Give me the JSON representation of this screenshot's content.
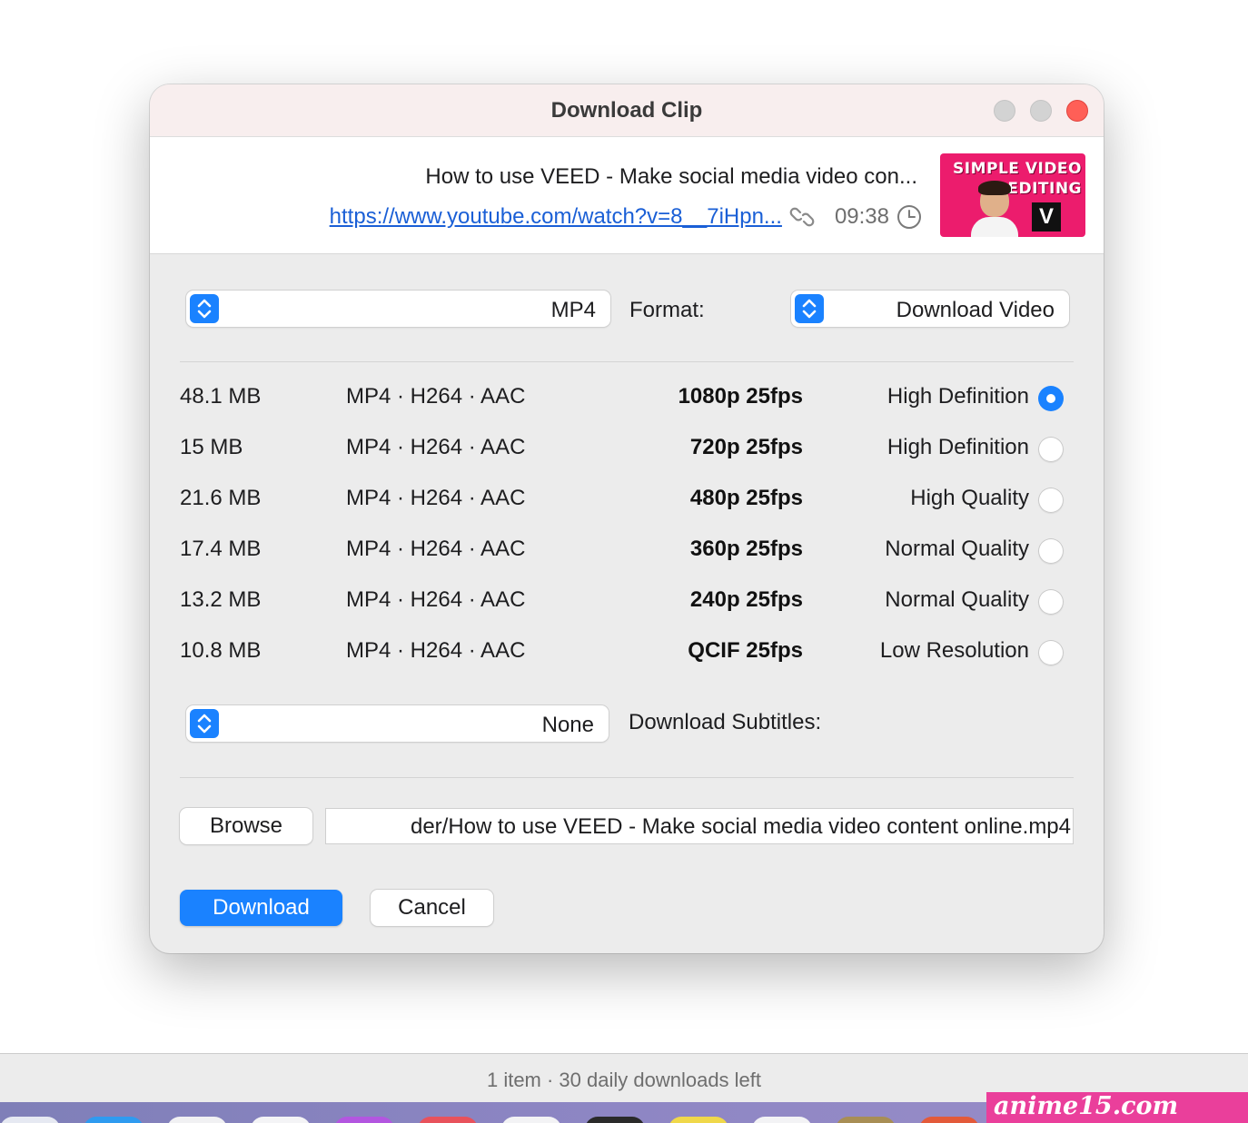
{
  "dialog": {
    "title": "Download Clip"
  },
  "video": {
    "title": "How to use VEED - Make social media video con...",
    "url": "https://www.youtube.com/watch?v=8__7iHpn...",
    "duration": "09:38",
    "thumbnail": {
      "line1": "SIMPLE VIDEO",
      "line2": "EDITING",
      "badge": "V"
    }
  },
  "download_type": {
    "value": "Download Video"
  },
  "format": {
    "label": "Format:",
    "value": "MP4"
  },
  "qualities": [
    {
      "label": "High Definition",
      "resolution": "1080p 25fps",
      "codec": "MP4 · H264 · AAC",
      "size": "48.1 MB",
      "selected": true
    },
    {
      "label": "High Definition",
      "resolution": "720p 25fps",
      "codec": "MP4 · H264 · AAC",
      "size": "15 MB",
      "selected": false
    },
    {
      "label": "High Quality",
      "resolution": "480p 25fps",
      "codec": "MP4 · H264 · AAC",
      "size": "21.6 MB",
      "selected": false
    },
    {
      "label": "Normal Quality",
      "resolution": "360p 25fps",
      "codec": "MP4 · H264 · AAC",
      "size": "17.4 MB",
      "selected": false
    },
    {
      "label": "Normal Quality",
      "resolution": "240p 25fps",
      "codec": "MP4 · H264 · AAC",
      "size": "13.2 MB",
      "selected": false
    },
    {
      "label": "Low Resolution",
      "resolution": "QCIF 25fps",
      "codec": "MP4 · H264 · AAC",
      "size": "10.8 MB",
      "selected": false
    }
  ],
  "subtitles": {
    "label": "Download Subtitles:",
    "value": "None"
  },
  "save_path": {
    "value": "der/How to use VEED - Make social media video content online.mp4",
    "browse_label": "Browse"
  },
  "actions": {
    "cancel_label": "Cancel",
    "download_label": "Download"
  },
  "status": {
    "text": "1 item · 30 daily downloads left"
  },
  "watermark": {
    "text": "anime15.com"
  },
  "colors": {
    "accent": "#1a82ff",
    "close": "#ff5f57",
    "link": "#1a5fd6",
    "thumbnail_bg": "#ec1c6d",
    "watermark_bg": "#ea3f9b"
  }
}
